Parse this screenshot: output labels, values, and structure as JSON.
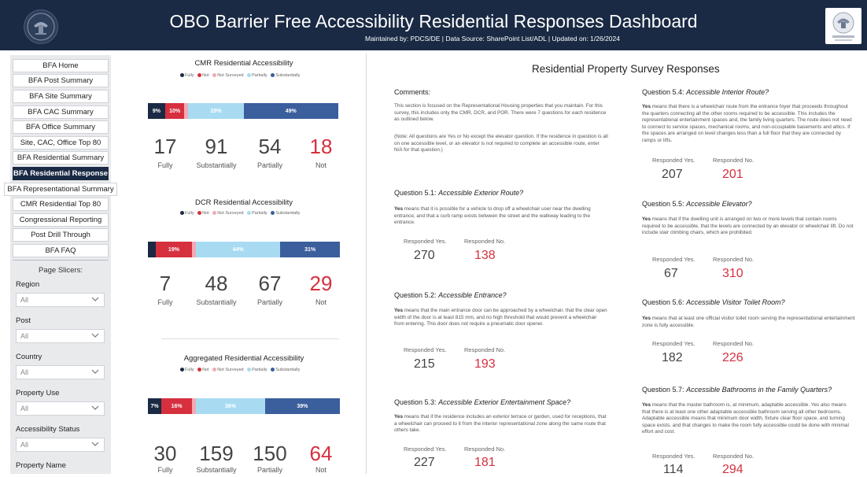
{
  "header": {
    "title": "OBO Barrier Free Accessibility Residential Responses Dashboard",
    "subtitle": "Maintained by: PDCS/DE | Data Source: SharePoint List/ADL | Updated on: 1/26/2024"
  },
  "nav": [
    "BFA Home",
    "BFA Post Summary",
    "BFA Site Summary",
    "BFA CAC Summary",
    "BFA Office Summary",
    "Site, CAC, Office Top 80",
    "BFA Residential Summary",
    "BFA Residential Responses",
    "BFA Representational Summary",
    "CMR Residential Top 80",
    "Congressional Reporting",
    "Post Drill Through",
    "BFA FAQ"
  ],
  "slicers": {
    "title": "Page Slicers:",
    "items": [
      {
        "label": "Region",
        "value": "All"
      },
      {
        "label": "Post",
        "value": "All"
      },
      {
        "label": "Country",
        "value": "All"
      },
      {
        "label": "Property Use",
        "value": "All"
      },
      {
        "label": "Accessibility Status",
        "value": "All"
      },
      {
        "label": "Property Name",
        "value": ""
      }
    ]
  },
  "legend": [
    "Fully",
    "Not",
    "Not Surveyed",
    "Partially",
    "Substantially"
  ],
  "colors": {
    "fully": "#1a2a44",
    "not": "#d6303f",
    "not_surveyed": "#f2aab3",
    "partially": "#a8dbf2",
    "substantially": "#3b5e9c",
    "header": "#1a2a44"
  },
  "charts": [
    {
      "title": "CMR Residential Accessibility",
      "segments": [
        {
          "key": "fully",
          "pct": 9,
          "label": "9%"
        },
        {
          "key": "not",
          "pct": 10,
          "label": "10%"
        },
        {
          "key": "not_surveyed",
          "pct": 2,
          "label": ""
        },
        {
          "key": "partially",
          "pct": 29,
          "label": "29%"
        },
        {
          "key": "substantially",
          "pct": 49,
          "label": "49%"
        }
      ],
      "counts": {
        "fully": "17",
        "substantially": "91",
        "partially": "54",
        "not": "18"
      }
    },
    {
      "title": "DCR Residential Accessibility",
      "segments": [
        {
          "key": "fully",
          "pct": 4,
          "label": ""
        },
        {
          "key": "not",
          "pct": 19,
          "label": "19%"
        },
        {
          "key": "not_surveyed",
          "pct": 2,
          "label": ""
        },
        {
          "key": "partially",
          "pct": 44,
          "label": "44%"
        },
        {
          "key": "substantially",
          "pct": 31,
          "label": "31%"
        }
      ],
      "counts": {
        "fully": "7",
        "substantially": "48",
        "partially": "67",
        "not": "29"
      }
    },
    {
      "title": "Aggregated Residential Accessibility",
      "segments": [
        {
          "key": "fully",
          "pct": 7,
          "label": "7%"
        },
        {
          "key": "not",
          "pct": 16,
          "label": "16%"
        },
        {
          "key": "not_surveyed",
          "pct": 2,
          "label": ""
        },
        {
          "key": "partially",
          "pct": 36,
          "label": "36%"
        },
        {
          "key": "substantially",
          "pct": 39,
          "label": "39%"
        }
      ],
      "counts": {
        "fully": "30",
        "substantially": "159",
        "partially": "150",
        "not": "64"
      }
    }
  ],
  "count_labels": {
    "fully": "Fully",
    "substantially": "Substantially",
    "partially": "Partially",
    "not": "Not"
  },
  "report": {
    "title": "Residential Property Survey Responses",
    "comments_head": "Comments:",
    "comments_p1": "This section is focused on the Representational Housing properties that you maintain.  For this survey, this includes only the CMR, DCR, and POR.  There were 7 questions for each residence as outlined below.",
    "comments_p2": "(Note: All questions are Yes or No except the elevator question.  If the residence in question is all on one accessible level, or an elevator is not required to complete an accessible route, enter N/A for that question.)",
    "yes_label": "Responded Yes.",
    "no_label": "Responded No.",
    "questions": [
      {
        "num": "Question 5.1:",
        "name": "Accessible Exterior Route?",
        "lead": "Yes",
        "text": " means that it is possible for a vehicle to drop off a wheelchair user near the dwelling entrance, and that a curb ramp exists between the street and the walkway leading to the entrance.",
        "yes": "270",
        "no": "138"
      },
      {
        "num": "Question 5.2:",
        "name": "Accessible Entrance?",
        "lead": "Yes",
        "text": " means that the main entrance door can be approached by a wheelchair, that the clear open width of the door is at least 815 mm, and no high threshold that would prevent a wheelchair from entering.  This door does not require a pneumatic door opener.",
        "yes": "215",
        "no": "193"
      },
      {
        "num": "Question 5.3:",
        "name": "Accessible Exterior Entertainment Space?",
        "lead": "Yes",
        "text": " means that if the residence includes an exterior terrace or garden, used for receptions, that a wheelchair can proceed to it from the interior representational zone along the same route that others take.",
        "yes": "227",
        "no": "181"
      },
      {
        "num": "Question 5.4:",
        "name": "Accessible Interior Route?",
        "lead": "Yes",
        "text": " means that there is a wheelchair route from the entrance foyer that proceeds throughout the quarters connecting all the other rooms required to be accessible.  This includes the representational entertainment spaces and, the family living quarters.  The route does not need to connect to service spaces, mechanical rooms, and non-occupiable basements and attics.  If the spaces are arranged on level changes less than a full floor that they are connected by ramps or lifts.",
        "yes": "207",
        "no": "201"
      },
      {
        "num": "Question 5.5:",
        "name": "Accessible Elevator?",
        "lead": "Yes",
        "text": " means that if the dwelling unit is arranged on two or more levels that contain rooms required to be accessible, that the levels are connected by an elevator or wheelchair lift.  Do not include stair climbing chairs, which are prohibited.",
        "yes": "67",
        "no": "310"
      },
      {
        "num": "Question 5.6:",
        "name": "Accessible Visitor Toilet Room?",
        "lead": "Yes",
        "text": " means that at least one official visitor toilet room serving the representational entertainment zone is fully accessible.",
        "yes": "182",
        "no": "226"
      },
      {
        "num": "Question 5.7:",
        "name": "Accessible Bathrooms in the Family Quarters?",
        "lead": "Yes",
        "text": " means that the master bathroom is, at minimum, adaptable accessible.  Yes also means that there is at least one other adaptable accessible bathroom serving all other bedrooms.  Adaptable accessible means that minimum door width, fixture clear floor space, and turning space exists, and that changes to make the room fully accessible could be done with minimal effort and cost.",
        "yes": "114",
        "no": "294"
      }
    ]
  }
}
